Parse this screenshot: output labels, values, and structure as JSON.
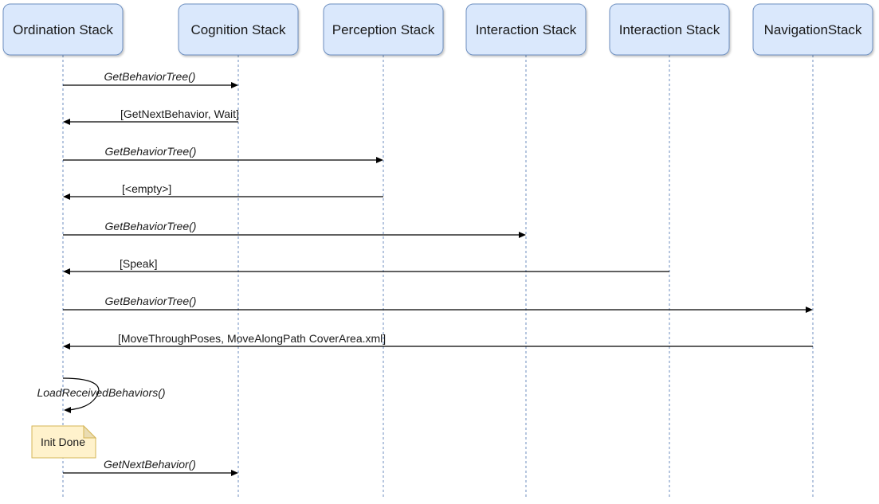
{
  "diagram": {
    "type": "sequence-diagram",
    "colors": {
      "actor_fill": "#dae8fc",
      "actor_stroke": "#6c8ebf",
      "note_fill": "#fff2cc",
      "note_stroke": "#d6b656",
      "message_line": "#000000"
    },
    "participants": [
      {
        "id": "ordination",
        "label": "Ordination Stack"
      },
      {
        "id": "cognition",
        "label": "Cognition Stack"
      },
      {
        "id": "perception",
        "label": "Perception Stack"
      },
      {
        "id": "interaction1",
        "label": "Interaction Stack"
      },
      {
        "id": "interaction2",
        "label": "Interaction Stack"
      },
      {
        "id": "navigation",
        "label": "NavigationStack"
      }
    ],
    "messages": [
      {
        "from": 0,
        "to": 1,
        "label": "GetBehaviorTree()",
        "kind": "call"
      },
      {
        "from": 1,
        "to": 0,
        "label": "[GetNextBehavior, Wait]",
        "kind": "reply"
      },
      {
        "from": 0,
        "to": 2,
        "label": "GetBehaviorTree()",
        "kind": "call"
      },
      {
        "from": 2,
        "to": 0,
        "label": "[<empty>]",
        "kind": "reply"
      },
      {
        "from": 0,
        "to": 3,
        "label": "GetBehaviorTree()",
        "kind": "call"
      },
      {
        "from": 4,
        "to": 0,
        "label": "[Speak]",
        "kind": "reply"
      },
      {
        "from": 0,
        "to": 5,
        "label": "GetBehaviorTree()",
        "kind": "call"
      },
      {
        "from": 5,
        "to": 0,
        "label": "[MoveThroughPoses, MoveAlongPath CoverArea.xml]",
        "kind": "reply"
      },
      {
        "from": 0,
        "to": 0,
        "label": "LoadReceivedBehaviors()",
        "kind": "self"
      },
      {
        "note": true,
        "on": 0,
        "label": "Init Done"
      },
      {
        "from": 0,
        "to": 1,
        "label": "GetNextBehavior()",
        "kind": "call"
      }
    ]
  }
}
